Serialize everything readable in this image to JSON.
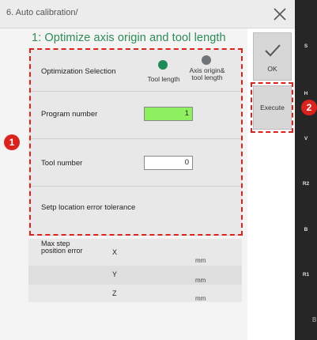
{
  "window": {
    "title": "6. Auto calibration/"
  },
  "section": {
    "heading": "1: Optimize axis origin and tool length"
  },
  "optimization": {
    "label": "Optimization Selection",
    "options": [
      {
        "label": "Tool length",
        "color": "#1e8a5a",
        "selected": true
      },
      {
        "label": "Axis origin& tool length",
        "color": "#6f7478",
        "selected": false
      }
    ]
  },
  "program": {
    "label": "Program number",
    "value": "1"
  },
  "tool": {
    "label": "Tool number",
    "value": "0"
  },
  "tolerance": {
    "label": "Setp location error tolerance"
  },
  "max_step": {
    "label": "Max step position error",
    "rows": [
      {
        "axis": "X",
        "unit": "mm"
      },
      {
        "axis": "Y",
        "unit": "mm"
      },
      {
        "axis": "Z",
        "unit": "mm"
      }
    ]
  },
  "buttons": {
    "ok": "OK",
    "execute": "Execute"
  },
  "side_strip": {
    "labels": [
      "S",
      "H",
      "V",
      "R2",
      "B",
      "R1",
      "B"
    ]
  },
  "callouts": [
    "1",
    "2"
  ],
  "colors": {
    "accent_green": "#2e8b57",
    "input_highlight": "#8ef05e",
    "callout_red": "#d9231f"
  }
}
